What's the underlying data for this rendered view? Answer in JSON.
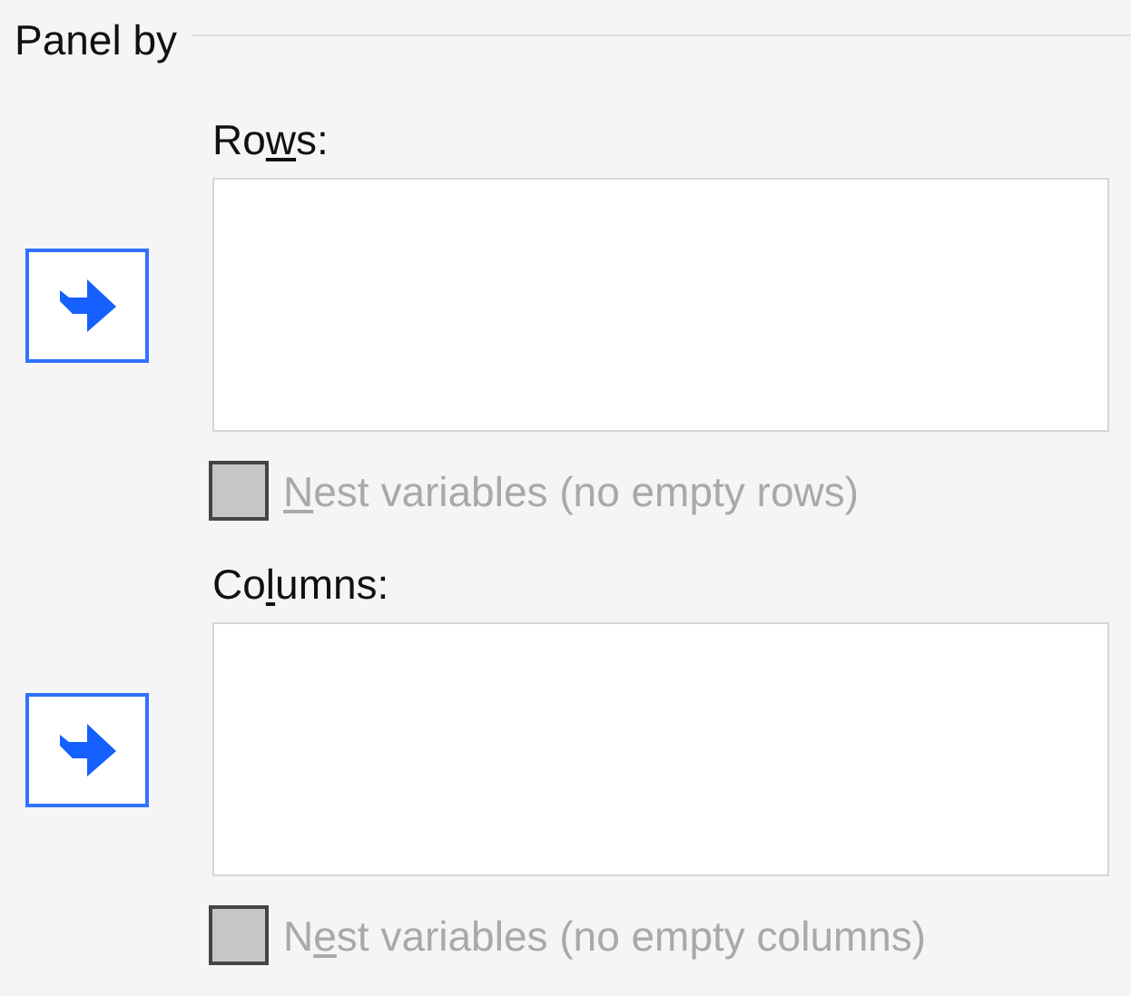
{
  "group": {
    "title": "Panel by"
  },
  "sections": [
    {
      "label": {
        "before": "Ro",
        "access_key": "w",
        "after": "s:"
      },
      "move_button": {
        "disabled": false
      },
      "checkbox": {
        "label": {
          "access_key": "N",
          "after": "est variables (no empty rows)"
        },
        "checked": false,
        "disabled": true
      }
    },
    {
      "label": {
        "before": "Co",
        "access_key": "l",
        "after": "umns:"
      },
      "move_button": {
        "disabled": false
      },
      "checkbox": {
        "label": {
          "before": "N",
          "access_key": "e",
          "after": "st variables (no empty columns)"
        },
        "checked": false,
        "disabled": true
      }
    }
  ]
}
